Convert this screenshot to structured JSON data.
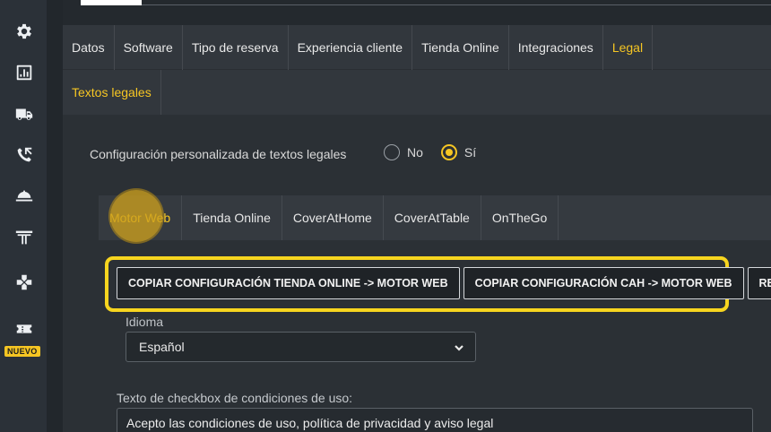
{
  "sidebar": {
    "icons": [
      "gear-icon",
      "chart-icon",
      "truck-icon",
      "phone-icon",
      "cloche-icon",
      "torii-icon",
      "gamepad-icon",
      "ticket-icon"
    ],
    "new_badge": "NUEVO"
  },
  "main_tabs": [
    {
      "label": "Datos",
      "active": false
    },
    {
      "label": "Software",
      "active": false
    },
    {
      "label": "Tipo de reserva",
      "active": false
    },
    {
      "label": "Experiencia cliente",
      "active": false
    },
    {
      "label": "Tienda Online",
      "active": false
    },
    {
      "label": "Integraciones",
      "active": false
    },
    {
      "label": "Legal",
      "active": true
    }
  ],
  "sub_nav": {
    "label": "Textos legales"
  },
  "config": {
    "label": "Configuración personalizada de textos legales",
    "options": [
      {
        "label": "No",
        "checked": false
      },
      {
        "label": "Sí",
        "checked": true
      }
    ]
  },
  "channel_tabs": [
    {
      "label": "Motor Web",
      "active": true
    },
    {
      "label": "Tienda Online",
      "active": false
    },
    {
      "label": "CoverAtHome",
      "active": false
    },
    {
      "label": "CoverAtTable",
      "active": false
    },
    {
      "label": "OnTheGo",
      "active": false
    }
  ],
  "copy_buttons": [
    "COPIAR CONFIGURACIÓN TIENDA ONLINE -> MOTOR WEB",
    "COPIAR CONFIGURACIÓN CAH -> MOTOR WEB",
    "RESTAU"
  ],
  "language": {
    "label": "Idioma",
    "value": "Español"
  },
  "checkbox_text": {
    "label": "Texto de checkbox de condiciones de uso:",
    "value": "Acepto las condiciones de uso, política de privacidad y aviso legal"
  },
  "colors": {
    "accent": "#f6c623",
    "highlight": "#f7d51f",
    "background": "#2b3035",
    "sidebar": "#2b3138"
  }
}
